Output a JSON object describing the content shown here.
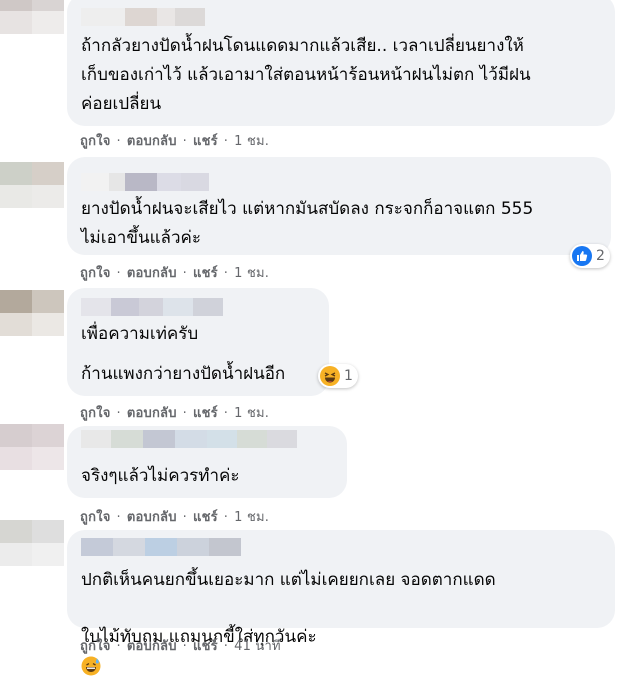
{
  "comments": [
    {
      "text": "ถ้ากลัวยางปัดน้ำฝนโดนแดดมากแล้วเสีย.. เวลาเปลี่ยนยางให้\nเก็บของเก่าไว้ แล้วเอามาใส่ตอนหน้าร้อนหน้าฝนไม่ตก ไว้มีฝน\nค่อยเปลี่ยน",
      "actions": {
        "like": "ถูกใจ",
        "reply": "ตอบกลับ",
        "share": "แชร์",
        "time": "1 ชม."
      }
    },
    {
      "text": "ยางปัดน้ำฝนจะเสียไว แต่หากมันสบัดลง กระจกก็อาจแตก 555\nไม่เอาขึ้นแล้วค่ะ",
      "reaction": {
        "icon": "like-reaction-icon",
        "count": "2"
      },
      "actions": {
        "like": "ถูกใจ",
        "reply": "ตอบกลับ",
        "share": "แชร์",
        "time": "1 ชม."
      }
    },
    {
      "line1": "เพื่อความเท่ครับ",
      "line2": "ก้านแพงกว่ายางปัดน้ำฝนอีก",
      "reaction": {
        "icon": "haha-reaction-icon",
        "count": "1"
      },
      "actions": {
        "like": "ถูกใจ",
        "reply": "ตอบกลับ",
        "share": "แชร์",
        "time": "1 ชม."
      }
    },
    {
      "text": "จริงๆแล้วไม่ควรทำค่ะ",
      "actions": {
        "like": "ถูกใจ",
        "reply": "ตอบกลับ",
        "share": "แชร์",
        "time": "1 ชม."
      }
    },
    {
      "line1": "ปกติเห็นคนยกขึ้นเยอะมาก แต่ไม่เคยยกเลย จอดตากแดด",
      "line2": "ใบไม้ทับถม แถมนกขี้ใส่ทุกวันค่ะ",
      "emoji": "grinning-sweat-emoji",
      "actions": {
        "like": "ถูกใจ",
        "reply": "ตอบกลับ",
        "share": "แชร์",
        "time": "41 นาที"
      }
    }
  ],
  "colors": {
    "bubble": "#f0f2f5",
    "meta_text": "#65676b",
    "like_blue": "#1877f2",
    "haha_yellow": "#f7b125"
  }
}
